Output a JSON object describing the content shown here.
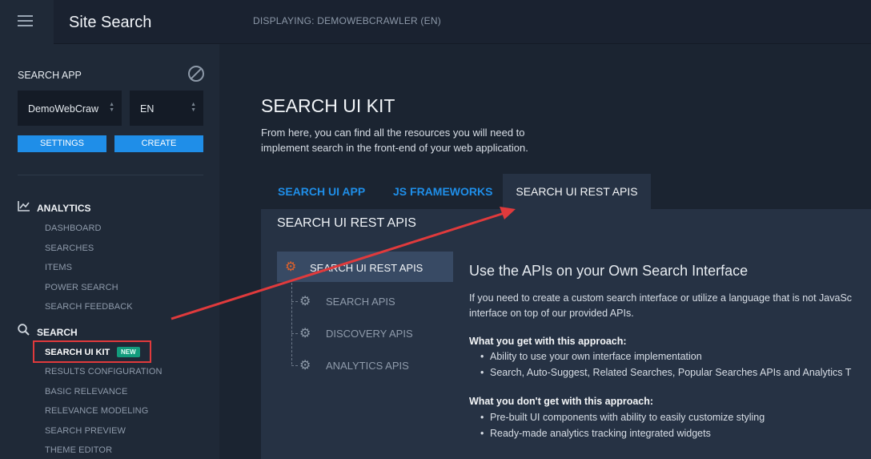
{
  "header": {
    "app_title": "Site Search",
    "displaying": "DISPLAYING: DEMOWEBCRAWLER (EN)"
  },
  "sidebar": {
    "section_label": "SEARCH APP",
    "app_select_value": "DemoWebCraw",
    "lang_select_value": "EN",
    "settings_label": "SETTINGS",
    "create_label": "CREATE",
    "analytics": {
      "heading": "ANALYTICS",
      "items": [
        "DASHBOARD",
        "SEARCHES",
        "ITEMS",
        "POWER SEARCH",
        "SEARCH FEEDBACK"
      ]
    },
    "search": {
      "heading": "SEARCH",
      "active_item": "SEARCH UI KIT",
      "badge": "NEW",
      "items": [
        "RESULTS CONFIGURATION",
        "BASIC RELEVANCE",
        "RELEVANCE MODELING",
        "SEARCH PREVIEW",
        "THEME EDITOR"
      ]
    }
  },
  "main": {
    "title": "SEARCH UI KIT",
    "description": "From here, you can find all the resources you will need to implement search in the front-end of your web application.",
    "tabs": [
      "SEARCH UI APP",
      "JS FRAMEWORKS",
      "SEARCH UI REST APIS"
    ],
    "panel_title": "SEARCH UI REST APIS",
    "api_nav": {
      "active": "SEARCH UI REST APIS",
      "items": [
        "SEARCH APIS",
        "DISCOVERY APIS",
        "ANALYTICS APIS"
      ]
    },
    "content": {
      "heading": "Use the APIs on your Own Search Interface",
      "paragraph_line1": "If you need to create a custom search interface or utilize a language that is not JavaSc",
      "paragraph_line2": "interface on top of our provided APIs.",
      "get_heading": "What you get with this approach:",
      "get_items": [
        "Ability to use your own interface implementation",
        "Search, Auto-Suggest, Related Searches, Popular Searches APIs and Analytics T"
      ],
      "dont_heading": "What you don't get with this approach:",
      "dont_items": [
        "Pre-built UI components with ability to easily customize styling",
        "Ready-made analytics tracking integrated widgets"
      ]
    }
  },
  "colors": {
    "accent": "#1f8ee8",
    "badge": "#139b7c",
    "annotation": "#e03a3c",
    "active_icon": "#e2622a"
  }
}
